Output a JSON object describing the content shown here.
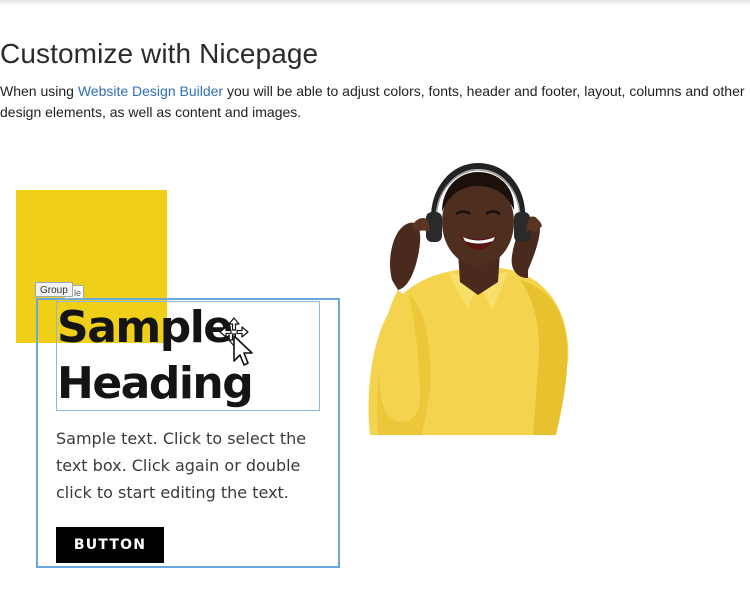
{
  "article": {
    "title": "Customize with Nicepage",
    "intro_before_link": "When using ",
    "intro_link": "Website Design Builder",
    "intro_after_link": " you will be able to adjust colors, fonts, header and footer, layout, columns and other design elements, as well as content and images."
  },
  "editor_demo": {
    "group_tag": "Group",
    "secondary_tag": "le",
    "heading": "Sample Heading",
    "body_text": "Sample text. Click to select the text box. Click again or double click to start editing the text.",
    "button_label": "BUTTON",
    "cursor_icon": "move-cursor-icon",
    "colors": {
      "accent_square": "#efcf17",
      "selection_border": "#6aa6dc",
      "button_bg": "#000000",
      "link": "#2f6fb7"
    }
  },
  "photo": {
    "icon": "person-with-headphones-image"
  }
}
